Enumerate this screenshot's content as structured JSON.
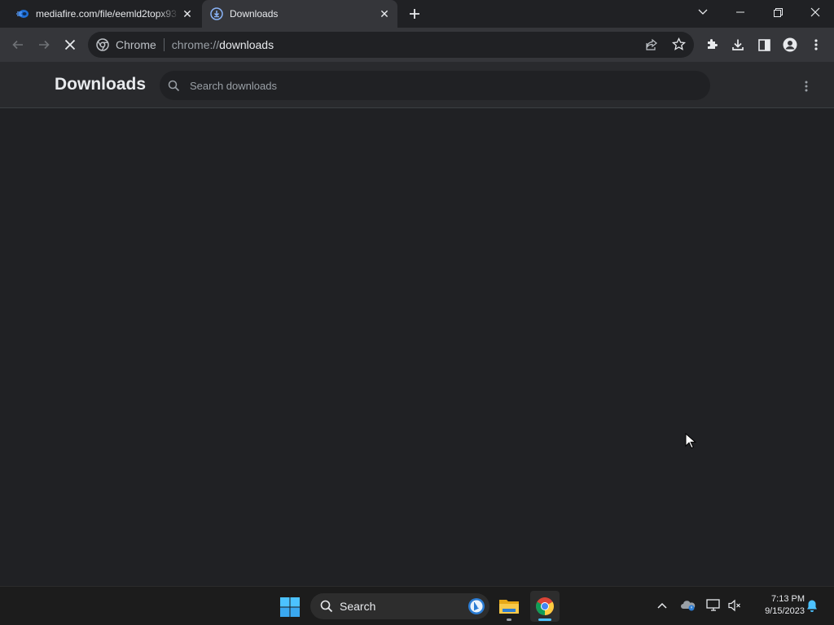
{
  "browser": {
    "tabs": [
      {
        "title": "mediafire.com/file/eemld2topx93",
        "icon": "mediafire-icon",
        "active": false
      },
      {
        "title": "Downloads",
        "icon": "chrome-downloads-icon",
        "active": true
      }
    ],
    "omnibox": {
      "site_label": "Chrome",
      "url_scheme": "chrome://",
      "url_host": "downloads"
    }
  },
  "page": {
    "title": "Downloads",
    "search_placeholder": "Search downloads"
  },
  "taskbar": {
    "search_label": "Search",
    "time": "7:13 PM",
    "date": "9/15/2023"
  },
  "colors": {
    "background": "#202124",
    "toolbar": "#35363a",
    "accent": "#8ab4f8"
  }
}
